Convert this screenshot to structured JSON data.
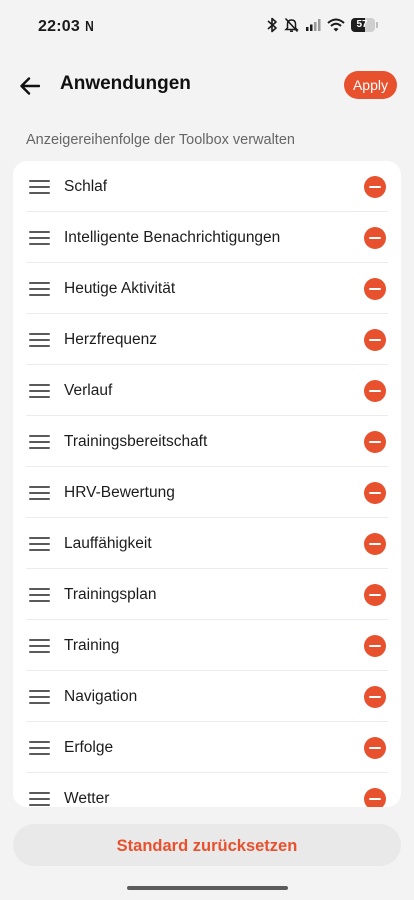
{
  "status_bar": {
    "time": "22:03",
    "notification_letter": "N",
    "battery_level": "57",
    "battery_fraction": 0.57,
    "icons": [
      "bluetooth-icon",
      "bell-muted-icon",
      "signal-icon",
      "wifi-icon",
      "battery-icon"
    ]
  },
  "header": {
    "back_icon": "arrow-left-icon",
    "title": "Anwendungen",
    "apply_label": "Apply"
  },
  "section_label": "Anzeigereihenfolge der Toolbox verwalten",
  "list": {
    "items": [
      {
        "label": "Schlaf"
      },
      {
        "label": "Intelligente Benachrichtigungen"
      },
      {
        "label": "Heutige Aktivität"
      },
      {
        "label": "Herzfrequenz"
      },
      {
        "label": "Verlauf"
      },
      {
        "label": "Trainingsbereitschaft"
      },
      {
        "label": "HRV-Bewertung"
      },
      {
        "label": "Lauffähigkeit"
      },
      {
        "label": "Trainingsplan"
      },
      {
        "label": "Training"
      },
      {
        "label": "Navigation"
      },
      {
        "label": "Erfolge"
      },
      {
        "label": "Wetter"
      }
    ]
  },
  "reset_label": "Standard zurücksetzen",
  "colors": {
    "accent": "#e8512e",
    "background": "#f3f3f3",
    "card": "#ffffff"
  }
}
